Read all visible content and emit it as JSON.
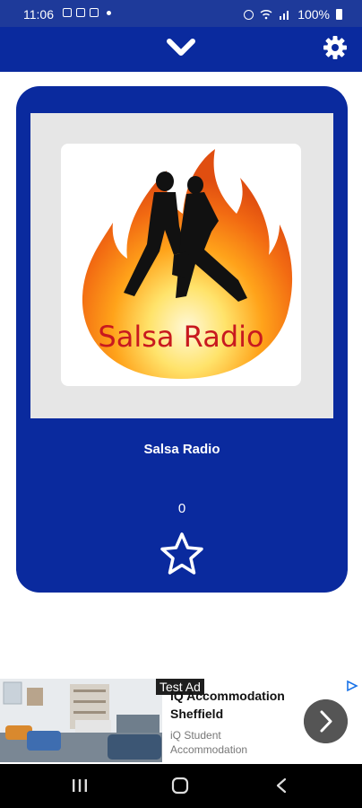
{
  "status_bar": {
    "time": "11:06",
    "battery": "100%"
  },
  "header": {
    "collapse_icon": "chevron-down-icon",
    "settings_icon": "gear-icon"
  },
  "station": {
    "name": "Salsa Radio",
    "logo_text": "Salsa Radio",
    "listeners": "0",
    "favorite_icon": "star-outline-icon"
  },
  "player": {
    "state_icon": "pause-icon"
  },
  "ad": {
    "badge": "Test Ad",
    "title": "iQ Accommodation Sheffield",
    "advertiser": "iQ Student Accommodation"
  },
  "colors": {
    "primary": "#0a2a9e",
    "status_bar": "#1e3a9a",
    "frame": "#e6e6e6",
    "logo_text": "#c8191f"
  }
}
